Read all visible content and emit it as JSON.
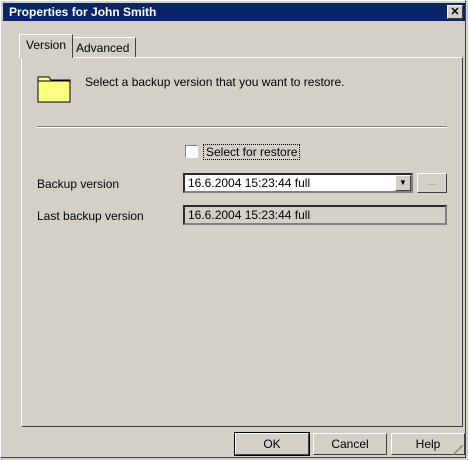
{
  "window": {
    "title": "Properties for John Smith",
    "close_label": "✕"
  },
  "tabs": [
    {
      "label": "Version",
      "active": true
    },
    {
      "label": "Advanced",
      "active": false
    }
  ],
  "version_panel": {
    "description": "Select a backup version that you want to restore.",
    "select_for_restore": {
      "label": "Select for restore",
      "checked": false
    },
    "backup_version": {
      "label": "Backup version",
      "value": "16.6.2004 15:23:44 full",
      "browse_label": "..."
    },
    "last_backup_version": {
      "label": "Last backup version",
      "value": "16.6.2004 15:23:44 full"
    }
  },
  "buttons": {
    "ok": "OK",
    "cancel": "Cancel",
    "help": "Help"
  },
  "icons": {
    "folder": "folder-icon",
    "dropdown": "chevron-down-icon",
    "close": "close-icon"
  },
  "colors": {
    "titlebar": "#0a246a",
    "dialog_bg": "#d4d0c8",
    "folder_yellow": "#ffff80"
  }
}
